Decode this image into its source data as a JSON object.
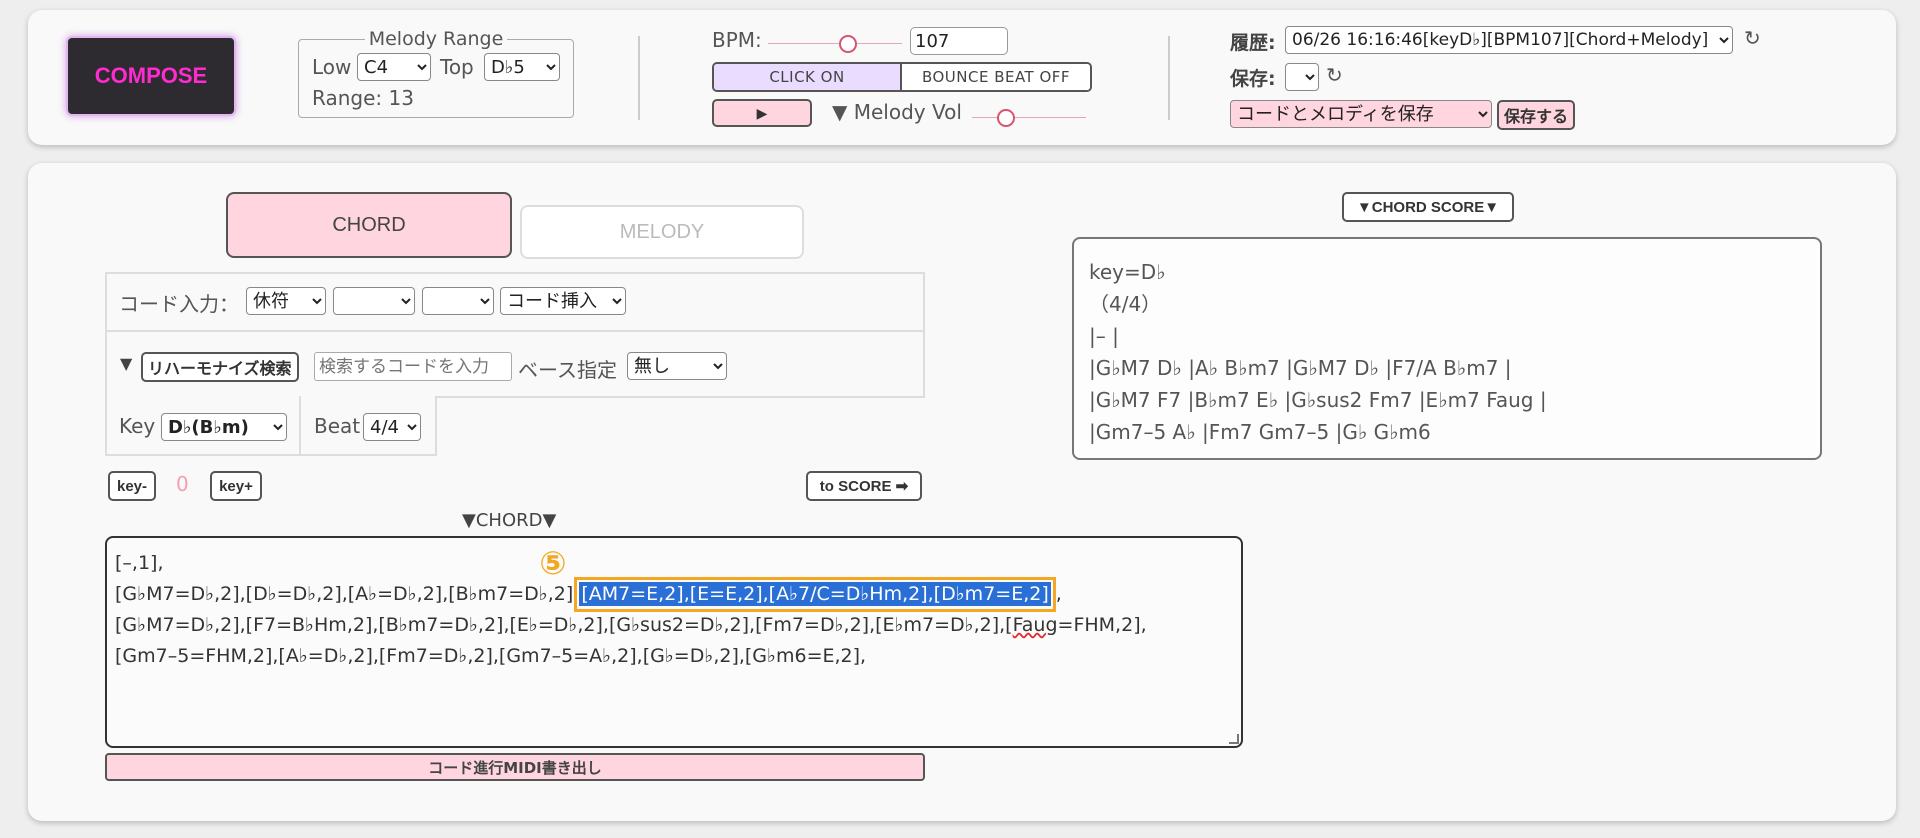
{
  "header": {
    "compose_label": "COMPOSE",
    "melody_range": {
      "legend": "Melody Range",
      "low_label": "Low",
      "low_value": "C4",
      "top_label": "Top",
      "top_value": "D♭5",
      "range_label": "Range: 13"
    },
    "bpm": {
      "label": "BPM:",
      "value": "107",
      "slider_fraction": 0.6
    },
    "click_label": "CLICK ON",
    "bounce_label": "BOUNCE BEAT OFF",
    "play_icon": "▶",
    "melody_vol_label": "▼ Melody Vol",
    "melody_vol_fraction": 0.3,
    "history": {
      "label": "履歴:",
      "value": "06/26 16:16:46[keyD♭][BPM107][Chord+Melody]"
    },
    "save": {
      "label": "保存:",
      "value": "",
      "mode_value": "コードとメロディを保存",
      "button_label": "保存する"
    },
    "refresh_icon": "↻"
  },
  "tabs": {
    "chord": "CHORD",
    "melody": "MELODY"
  },
  "chord_input": {
    "label": "コード入力：",
    "rest_value": "休符",
    "select2_value": "",
    "select3_value": "",
    "insert_value": "コード挿入",
    "toggle_icon": "▼",
    "reharmonize_label": "リハーモナイズ検索",
    "search_placeholder": "検索するコードを入力",
    "bass_label": "ベース指定",
    "bass_value": "無し",
    "key_label": "Key",
    "key_value": "D♭(B♭m)",
    "beat_label": "Beat",
    "beat_value": "4/4"
  },
  "transpose": {
    "minus": "key-",
    "value": "0",
    "plus": "key+",
    "to_score": "to SCORE ➡"
  },
  "chord_area": {
    "title": "▼CHORD▼",
    "marker": "⑤",
    "line1": "[–,1],",
    "line2_pre": "[G♭M7=D♭,2],[D♭=D♭,2],[A♭=D♭,2],[B♭m7=D♭,2] ",
    "line2_sel": "[AM7=E,2],[E=E,2],[A♭7/C=D♭Hm,2],[D♭m7=E,2]",
    "line2_post": ",",
    "line3_pre": "[G♭M7=D♭,2],[F7=B♭Hm,2],[B♭m7=D♭,2],[E♭=D♭,2],[G♭sus2=D♭,2],[Fm7=D♭,2],[E♭m7=D♭,2],[",
    "line3_typo": "Faug",
    "line3_post": "=FHM,2],",
    "line4": "[Gm7–5=FHM,2],[A♭=D♭,2],[Fm7=D♭,2],[Gm7–5=A♭,2],[G♭=D♭,2],[G♭m6=E,2],",
    "export_label": "コード進行MIDI書き出し"
  },
  "score": {
    "title": "▼CHORD SCORE▼",
    "lines": [
      "key=D♭",
      "（4/4）",
      "|– |",
      "|G♭M7 D♭ |A♭ B♭m7 |G♭M7 D♭ |F7/A B♭m7 |",
      "|G♭M7 F7 |B♭m7 E♭ |G♭sus2 Fm7 |E♭m7 Faug |",
      "|Gm7–5 A♭ |Fm7 Gm7–5 |G♭ G♭m6"
    ]
  },
  "colors": {
    "accent_pink": "#ffd6df",
    "compose_text": "#ff2bd0",
    "selection": "#2a6fd6",
    "highlight_border": "#f5a623",
    "marker": "#f5a623"
  }
}
